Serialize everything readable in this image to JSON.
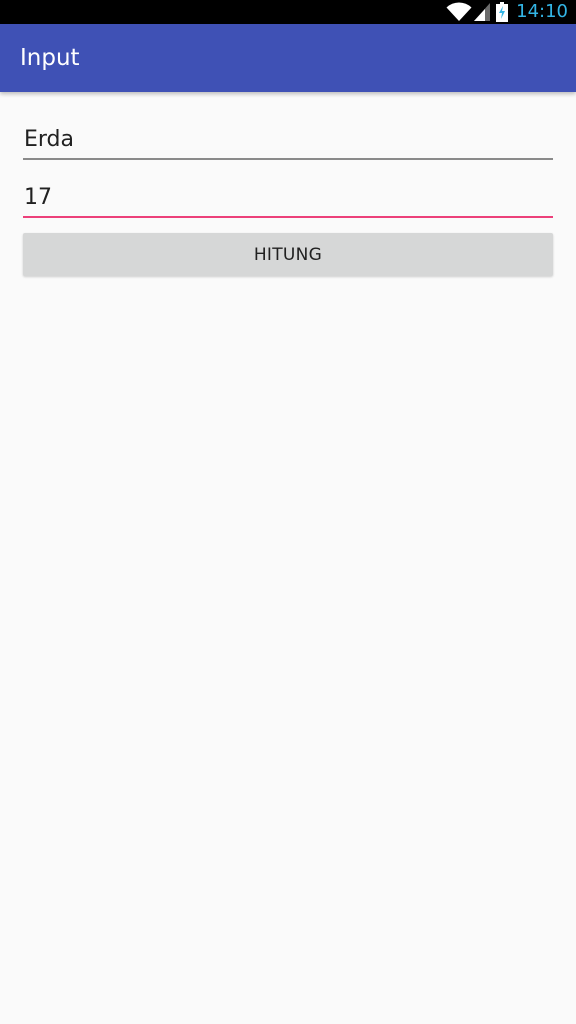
{
  "status_bar": {
    "time": "14:10",
    "icons": [
      "wifi-icon",
      "signal-icon",
      "battery-charging-icon"
    ],
    "clock_color": "#33b5e5"
  },
  "app_bar": {
    "title": "Input",
    "color": "#3f51b5"
  },
  "form": {
    "name_value": "Erda",
    "age_value": "17",
    "focused_accent": "#ec407a",
    "button_label": "HITUNG"
  }
}
